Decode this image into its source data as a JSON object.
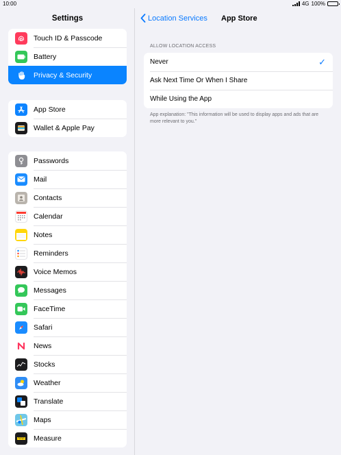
{
  "status_bar": {
    "time": "10:00",
    "network": "4G",
    "battery": "100%",
    "battery_level": 1.0
  },
  "sidebar": {
    "title": "Settings",
    "groups": [
      {
        "items": [
          {
            "label": "Touch ID & Passcode",
            "icon": "fingerprint-icon",
            "color": "#ff3b5c"
          },
          {
            "label": "Battery",
            "icon": "battery-icon",
            "color": "#34c759"
          },
          {
            "label": "Privacy & Security",
            "icon": "hand-icon",
            "color": "#0a84ff",
            "selected": true
          }
        ]
      },
      {
        "items": [
          {
            "label": "App Store",
            "icon": "app-store-icon",
            "color": "#0d84ff"
          },
          {
            "label": "Wallet & Apple Pay",
            "icon": "wallet-icon",
            "color": "#1c1c1e"
          }
        ]
      },
      {
        "items": [
          {
            "label": "Passwords",
            "icon": "key-icon",
            "color": "#8e8e93"
          },
          {
            "label": "Mail",
            "icon": "mail-icon",
            "color": "#1a8cff"
          },
          {
            "label": "Contacts",
            "icon": "contacts-icon",
            "color": "#b9b4ad"
          },
          {
            "label": "Calendar",
            "icon": "calendar-icon",
            "color": "#ffffff"
          },
          {
            "label": "Notes",
            "icon": "notes-icon",
            "color": "#ffd60a"
          },
          {
            "label": "Reminders",
            "icon": "reminders-icon",
            "color": "#ffffff"
          },
          {
            "label": "Voice Memos",
            "icon": "voice-memos-icon",
            "color": "#1c1c1e"
          },
          {
            "label": "Messages",
            "icon": "messages-icon",
            "color": "#34c759"
          },
          {
            "label": "FaceTime",
            "icon": "facetime-icon",
            "color": "#34c759"
          },
          {
            "label": "Safari",
            "icon": "safari-icon",
            "color": "#1a8cff"
          },
          {
            "label": "News",
            "icon": "news-icon",
            "color": "#ffffff"
          },
          {
            "label": "Stocks",
            "icon": "stocks-icon",
            "color": "#1c1c1e"
          },
          {
            "label": "Weather",
            "icon": "weather-icon",
            "color": "#2f8df5"
          },
          {
            "label": "Translate",
            "icon": "translate-icon",
            "color": "#1c1c1e"
          },
          {
            "label": "Maps",
            "icon": "maps-icon",
            "color": "#6fc7e8"
          },
          {
            "label": "Measure",
            "icon": "measure-icon",
            "color": "#1c1c1e"
          }
        ]
      }
    ]
  },
  "detail": {
    "back_label": "Location Services",
    "title": "App Store",
    "section_header": "ALLOW LOCATION ACCESS",
    "options": [
      {
        "label": "Never",
        "checked": true
      },
      {
        "label": "Ask Next Time Or When I Share",
        "checked": false
      },
      {
        "label": "While Using the App",
        "checked": false
      }
    ],
    "check_glyph": "✓",
    "footer": "App explanation: \"This information will be used to display apps and ads that are more relevant to you.\""
  }
}
